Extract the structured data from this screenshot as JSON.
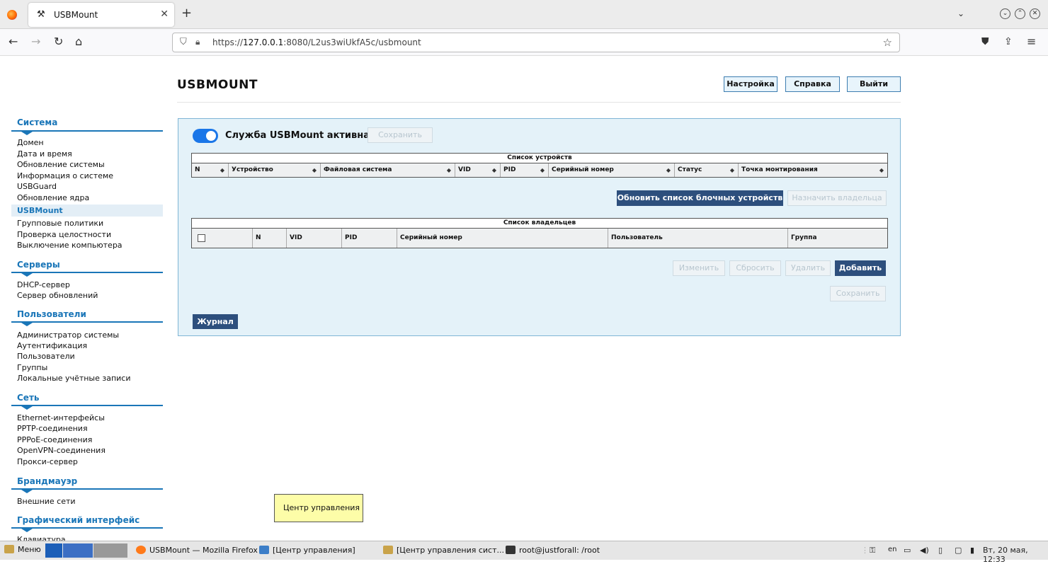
{
  "browser": {
    "tab_title": "USBMount",
    "url_prefix": "https://",
    "url_host": "127.0.0.1",
    "url_rest": ":8080/L2us3wiUkfA5c/usbmount"
  },
  "header": {
    "title": "USBMOUNT",
    "buttons": {
      "settings": "Настройка",
      "help": "Справка",
      "logout": "Выйти"
    }
  },
  "sidebar": {
    "sections": [
      {
        "title": "Система",
        "items": [
          "Домен",
          "Дата и время",
          "Обновление системы",
          "Информация о системе",
          "USBGuard",
          "Обновление ядра",
          "USBMount",
          "Групповые политики",
          "Проверка целостности",
          "Выключение компьютера"
        ]
      },
      {
        "title": "Серверы",
        "items": [
          "DHCP-сервер",
          "Сервер обновлений"
        ]
      },
      {
        "title": "Пользователи",
        "items": [
          "Администратор системы",
          "Аутентификация",
          "Пользователи",
          "Группы",
          "Локальные учётные записи"
        ]
      },
      {
        "title": "Сеть",
        "items": [
          "Ethernet-интерфейсы",
          "PPTP-соединения",
          "PPPoE-соединения",
          "OpenVPN-соединения",
          "Прокси-сервер"
        ]
      },
      {
        "title": "Брандмауэр",
        "items": [
          "Внешние сети"
        ]
      },
      {
        "title": "Графический интерфейс",
        "items": [
          "Клавиатура"
        ]
      }
    ],
    "active_item": "USBMount"
  },
  "service": {
    "label": "Служба USBMount активна",
    "save": "Сохранить",
    "enabled": true
  },
  "devices": {
    "caption": "Список устройств",
    "columns": [
      "N",
      "Устройство",
      "Файловая система",
      "VID",
      "PID",
      "Серийный номер",
      "Статус",
      "Точка монтирования"
    ],
    "refresh": "Обновить список блочных устройств",
    "assign": "Назначить владельца"
  },
  "owners": {
    "caption": "Список владельцев",
    "columns": [
      "N",
      "VID",
      "PID",
      "Серийный номер",
      "Пользователь",
      "Группа"
    ],
    "edit": "Изменить",
    "reset": "Сбросить",
    "delete": "Удалить",
    "add": "Добавить",
    "save": "Сохранить"
  },
  "journal": "Журнал",
  "tooltip": "Центр управления",
  "taskbar": {
    "menu": "Меню",
    "items": [
      "USBMount — Mozilla Firefox",
      "[Центр управления]",
      "[Центр управления сист...",
      "root@justforall: /root"
    ],
    "lang": "en",
    "clock": "Вт, 20 мая, 12:33"
  }
}
